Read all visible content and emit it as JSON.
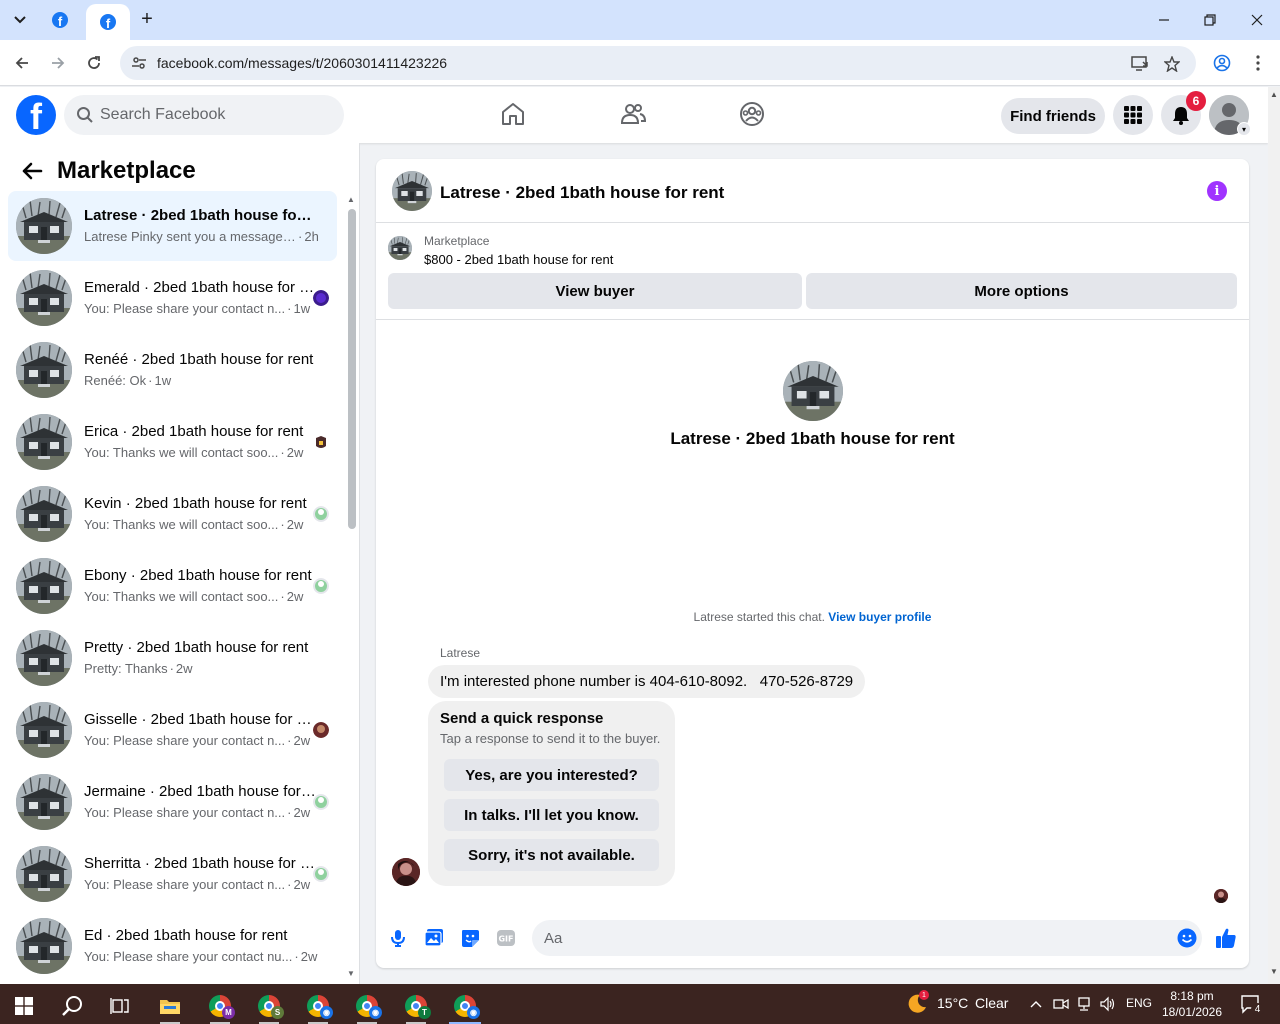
{
  "browser": {
    "url": "facebook.com/messages/t/2060301411423226"
  },
  "header": {
    "search_placeholder": "Search Facebook",
    "find_friends": "Find friends",
    "notification_count": "6"
  },
  "sidebar": {
    "title": "Marketplace",
    "conversations": [
      {
        "name": "Latrese · 2bed 1bath house for rent",
        "snippet": "Latrese Pinky sent you a message a...",
        "time": "2h",
        "active": true
      },
      {
        "name": "Emerald · 2bed 1bath house for rent",
        "snippet": "You: Please share your contact n...",
        "time": "1w"
      },
      {
        "name": "Renéé · 2bed 1bath house for rent",
        "snippet": "Renéé: Ok",
        "time": "1w"
      },
      {
        "name": "Erica · 2bed 1bath house for rent",
        "snippet": "You: Thanks we will contact soo...",
        "time": "2w"
      },
      {
        "name": "Kevin · 2bed 1bath house for rent",
        "snippet": "You: Thanks we will contact soo...",
        "time": "2w"
      },
      {
        "name": "Ebony · 2bed 1bath house for rent",
        "snippet": "You: Thanks we will contact soo...",
        "time": "2w"
      },
      {
        "name": "Pretty · 2bed 1bath house for rent",
        "snippet": "Pretty: Thanks",
        "time": "2w"
      },
      {
        "name": "Gisselle · 2bed 1bath house for rent",
        "snippet": "You: Please share your contact n...",
        "time": "2w"
      },
      {
        "name": "Jermaine · 2bed 1bath house for rent",
        "snippet": "You: Please share your contact n...",
        "time": "2w"
      },
      {
        "name": "Sherritta · 2bed 1bath house for rent",
        "snippet": "You: Please share your contact n...",
        "time": "2w"
      },
      {
        "name": "Ed · 2bed 1bath house for rent",
        "snippet": "You: Please share your contact nu...",
        "time": "2w"
      }
    ]
  },
  "chat": {
    "title": "Latrese · 2bed 1bath house for rent",
    "listing_label": "Marketplace",
    "listing_price": "$800 - 2bed 1bath house for rent",
    "view_buyer": "View buyer",
    "more_options": "More options",
    "intro_title": "Latrese · 2bed 1bath house for rent",
    "started_text": "Latrese started this chat.",
    "view_buyer_profile": "View buyer profile",
    "sender_name": "Latrese",
    "message": "I'm interested phone number is 404-610-8092.   470-526-8729",
    "quick_title": "Send a quick response",
    "quick_subtitle": "Tap a response to send it to the buyer.",
    "quick_responses": [
      "Yes, are you interested?",
      "In talks. I'll let you know.",
      "Sorry, it's not available."
    ],
    "composer_placeholder": "Aa"
  },
  "taskbar": {
    "weather_temp": "15°C",
    "weather_desc": "Clear",
    "weather_badge": "1",
    "language": "ENG",
    "time": "8:18 pm",
    "date": "18/01/2026",
    "notifications": "4",
    "chrome_badges": [
      "M",
      "S",
      "",
      "",
      "T",
      ""
    ]
  },
  "colors": {
    "fb_blue": "#0866ff",
    "active_conversation": "#ebf5ff",
    "info_purple": "#a033ff",
    "badge_red": "#e41e3f"
  }
}
